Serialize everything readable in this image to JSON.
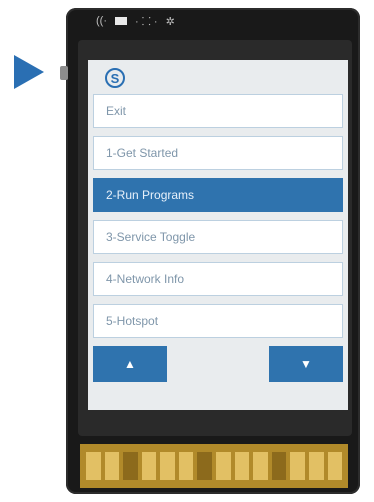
{
  "menu": {
    "logo_glyph": "S",
    "items": [
      {
        "label": "Exit"
      },
      {
        "label": "1-Get Started"
      },
      {
        "label": "2-Run Programs"
      },
      {
        "label": "3-Service Toggle"
      },
      {
        "label": "4-Network Info"
      },
      {
        "label": "5-Hotspot"
      }
    ],
    "selected_index": 2
  },
  "nav": {
    "up_label": "▲",
    "down_label": "▼"
  },
  "colors": {
    "accent": "#2f73ae",
    "pointer": "#2a6fb3",
    "screen_bg": "#e9ecee"
  }
}
